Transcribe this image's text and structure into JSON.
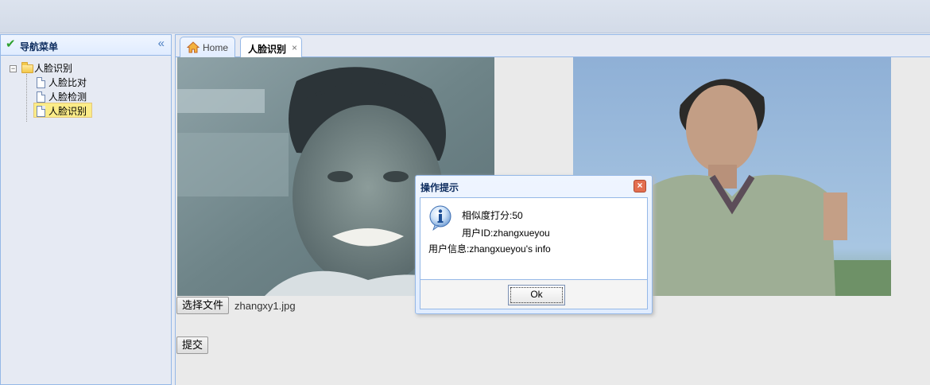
{
  "nav": {
    "title": "导航菜单",
    "tree": {
      "root_label": "人脸识别",
      "items": [
        "人脸比对",
        "人脸检测",
        "人脸识别"
      ]
    }
  },
  "tabs": [
    {
      "label": "Home",
      "icon": "home-icon"
    },
    {
      "label": "人脸识别",
      "active": true
    }
  ],
  "form": {
    "file_button_label": "选择文件",
    "file_name": "zhangxy1.jpg",
    "submit_label": "提交"
  },
  "dialog": {
    "title": "操作提示",
    "lines": [
      "相似度打分:50",
      "用户ID:zhangxueyou",
      "用户信息:zhangxueyou's info"
    ],
    "ok_label": "Ok"
  },
  "colors": {
    "panel_border": "#95B8E7",
    "selected_tree_item": "#FBEC88",
    "dialog_close": "#E36F50"
  }
}
